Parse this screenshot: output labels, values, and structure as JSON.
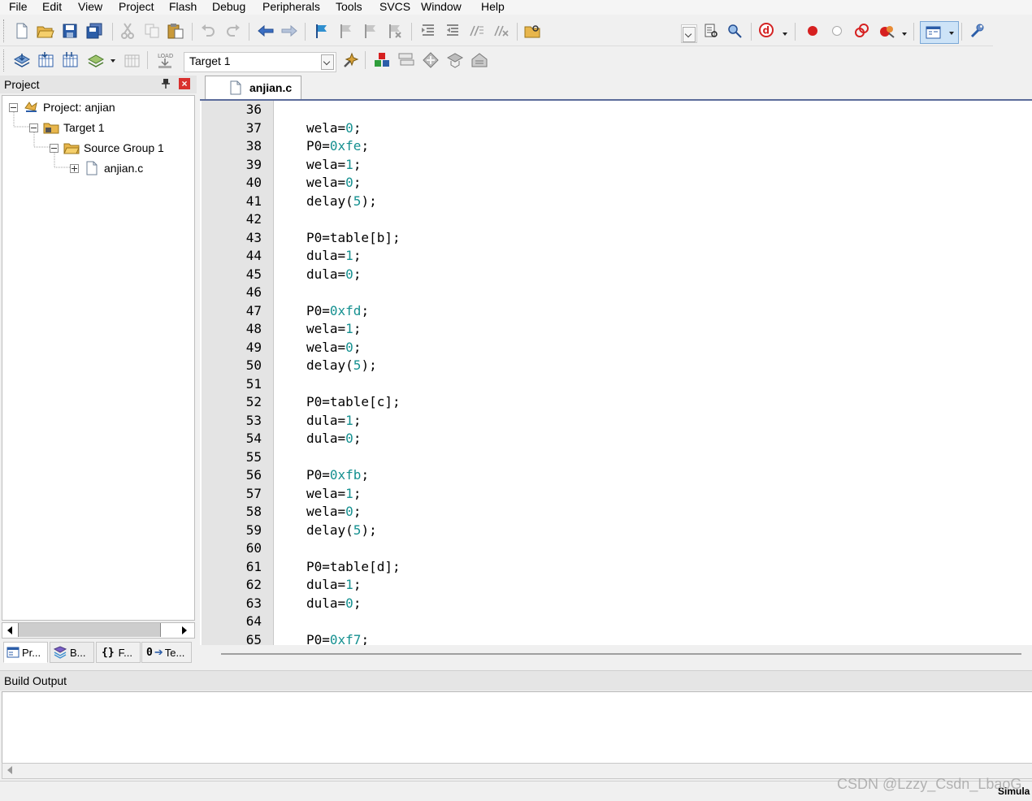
{
  "menu": [
    "File",
    "Edit",
    "View",
    "Project",
    "Flash",
    "Debug",
    "Peripherals",
    "Tools",
    "SVCS",
    "Window",
    "Help"
  ],
  "toolbar": {
    "target_select": "Target 1",
    "find_combo": ""
  },
  "project_panel": {
    "title": "Project",
    "close_glyph": "×",
    "tree": {
      "project": "Project: anjian",
      "target": "Target 1",
      "group": "Source Group 1",
      "file": "anjian.c"
    },
    "tabs": [
      "Pr...",
      "B...",
      "F...",
      "Te..."
    ],
    "tab_glyphs": [
      "{}",
      "0"
    ]
  },
  "editor": {
    "tab_label": "anjian.c",
    "lines": [
      {
        "n": "36",
        "code": ""
      },
      {
        "n": "37",
        "code": "wela=0;"
      },
      {
        "n": "38",
        "code": "P0=0xfe;"
      },
      {
        "n": "39",
        "code": "wela=1;"
      },
      {
        "n": "40",
        "code": "wela=0;"
      },
      {
        "n": "41",
        "code": "delay(5);"
      },
      {
        "n": "42",
        "code": ""
      },
      {
        "n": "43",
        "code": "P0=table[b];"
      },
      {
        "n": "44",
        "code": "dula=1;"
      },
      {
        "n": "45",
        "code": "dula=0;"
      },
      {
        "n": "46",
        "code": ""
      },
      {
        "n": "47",
        "code": "P0=0xfd;"
      },
      {
        "n": "48",
        "code": "wela=1;"
      },
      {
        "n": "49",
        "code": "wela=0;"
      },
      {
        "n": "50",
        "code": "delay(5);"
      },
      {
        "n": "51",
        "code": ""
      },
      {
        "n": "52",
        "code": "P0=table[c];"
      },
      {
        "n": "53",
        "code": "dula=1;"
      },
      {
        "n": "54",
        "code": "dula=0;"
      },
      {
        "n": "55",
        "code": ""
      },
      {
        "n": "56",
        "code": "P0=0xfb;"
      },
      {
        "n": "57",
        "code": "wela=1;"
      },
      {
        "n": "58",
        "code": "wela=0;"
      },
      {
        "n": "59",
        "code": "delay(5);"
      },
      {
        "n": "60",
        "code": ""
      },
      {
        "n": "61",
        "code": "P0=table[d];"
      },
      {
        "n": "62",
        "code": "dula=1;"
      },
      {
        "n": "63",
        "code": "dula=0;"
      },
      {
        "n": "64",
        "code": ""
      },
      {
        "n": "65",
        "code": "P0=0xf7;"
      }
    ]
  },
  "build_output": {
    "title": "Build Output"
  },
  "status": {
    "mode": "Simula"
  },
  "watermark": "CSDN @Lzzy_Csdn_LbaoG",
  "colors": {
    "number_literal": "#159090",
    "editor_border": "#5b6b9a",
    "breakpoint": "#d62020"
  }
}
